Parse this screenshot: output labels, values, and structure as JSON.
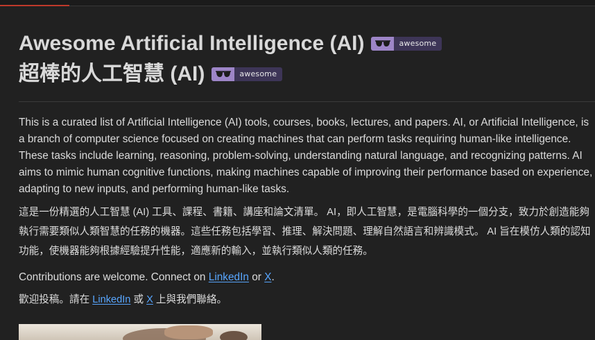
{
  "title_en": "Awesome Artificial Intelligence (AI)",
  "title_zh": "超棒的人工智慧 (AI)",
  "badge": {
    "label": "awesome",
    "icon": "sunglasses-icon",
    "left_color": "#9d85c7",
    "right_color": "#3d3557"
  },
  "intro_en": "This is a curated list of Artificial Intelligence (AI) tools, courses, books, lectures, and papers. AI, or Artificial Intelligence, is a branch of computer science focused on creating machines that can perform tasks requiring human-like intelligence. These tasks include learning, reasoning, problem-solving, understanding natural language, and recognizing patterns. AI aims to mimic human cognitive functions, making machines capable of improving their performance based on experience, adapting to new inputs, and performing human-like tasks.",
  "intro_zh": "這是一份精選的人工智慧 (AI) 工具、課程、書籍、講座和論文清單。 AI，即人工智慧，是電腦科學的一個分支，致力於創造能夠執行需要類似人類智慧的任務的機器。這些任務包括學習、推理、解決問題、理解自然語言和辨識模式。 AI 旨在模仿人類的認知功能，使機器能夠根據經驗提升性能，適應新的輸入，並執行類似人類的任務。",
  "contrib_en": {
    "prefix": "Contributions are welcome. Connect on ",
    "link1": "LinkedIn",
    "middle": " or ",
    "link2": "X",
    "suffix": "."
  },
  "contrib_zh": {
    "prefix": "歡迎投稿。請在 ",
    "link1": "LinkedIn",
    "middle": " 或 ",
    "link2": "X",
    "suffix": " 上與我們聯絡。"
  },
  "colors": {
    "link": "#58a6ff",
    "background": "#212121",
    "text": "#dcdcdc"
  }
}
